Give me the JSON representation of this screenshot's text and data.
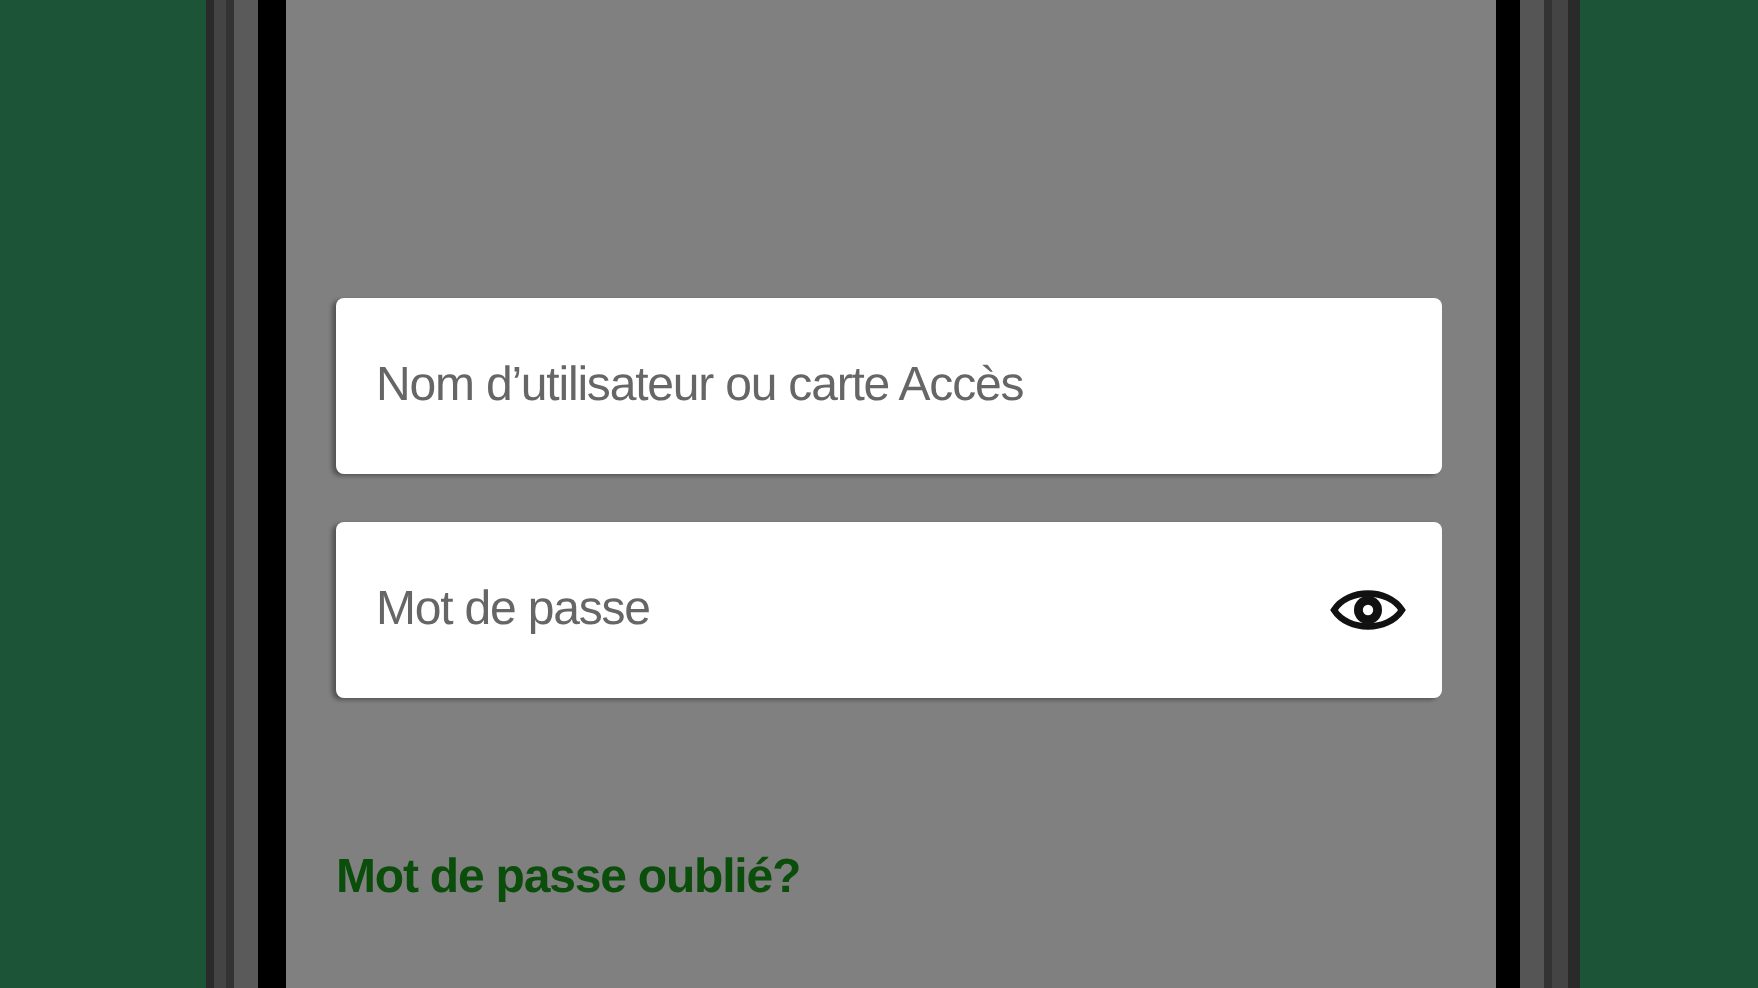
{
  "login_form": {
    "fields": [
      {
        "kind": "text",
        "placeholder": "Nom d’utilisateur ou carte Accès"
      },
      {
        "kind": "password",
        "placeholder": "Mot de passe"
      }
    ],
    "forgot_password_link": "Mot de passe oublié?"
  }
}
